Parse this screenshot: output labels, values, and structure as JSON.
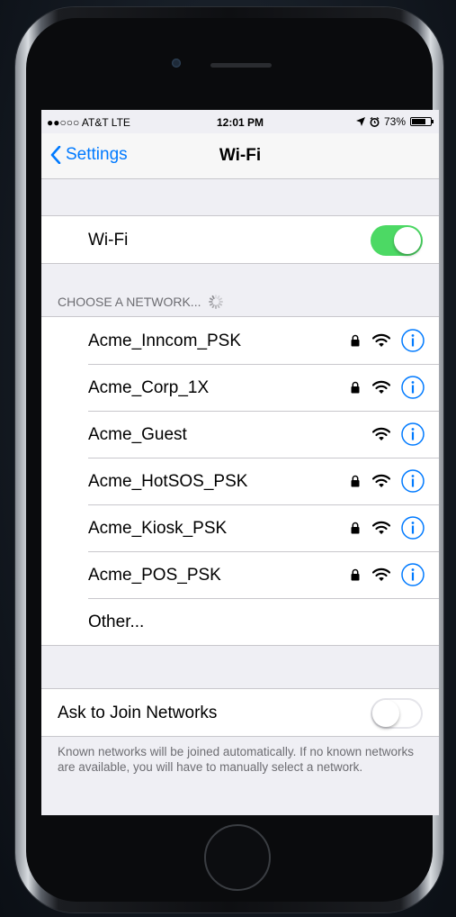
{
  "status_bar": {
    "carrier": "●●○○○ AT&T  LTE",
    "time": "12:01 PM",
    "battery": "73%",
    "battery_level": 0.73,
    "location_icon": "location-arrow-icon",
    "alarm_icon": "alarm-clock-icon"
  },
  "nav": {
    "back_label": "Settings",
    "title": "Wi-Fi"
  },
  "wifi_toggle": {
    "label": "Wi-Fi",
    "on": true
  },
  "section": {
    "header": "CHOOSE A NETWORK..."
  },
  "networks": [
    {
      "name": "Acme_Inncom_PSK",
      "secured": true
    },
    {
      "name": "Acme_Corp_1X",
      "secured": true
    },
    {
      "name": "Acme_Guest",
      "secured": false
    },
    {
      "name": "Acme_HotSOS_PSK",
      "secured": true
    },
    {
      "name": "Acme_Kiosk_PSK",
      "secured": true
    },
    {
      "name": "Acme_POS_PSK",
      "secured": true
    }
  ],
  "other_label": "Other...",
  "ask_to_join": {
    "label": "Ask to Join Networks",
    "on": false
  },
  "footer_text": "Known networks will be joined automatically. If no known networks are available, you will have to manually select a network.",
  "colors": {
    "accent": "#007aff",
    "toggle_on": "#4cd964",
    "background": "#efeff4"
  }
}
